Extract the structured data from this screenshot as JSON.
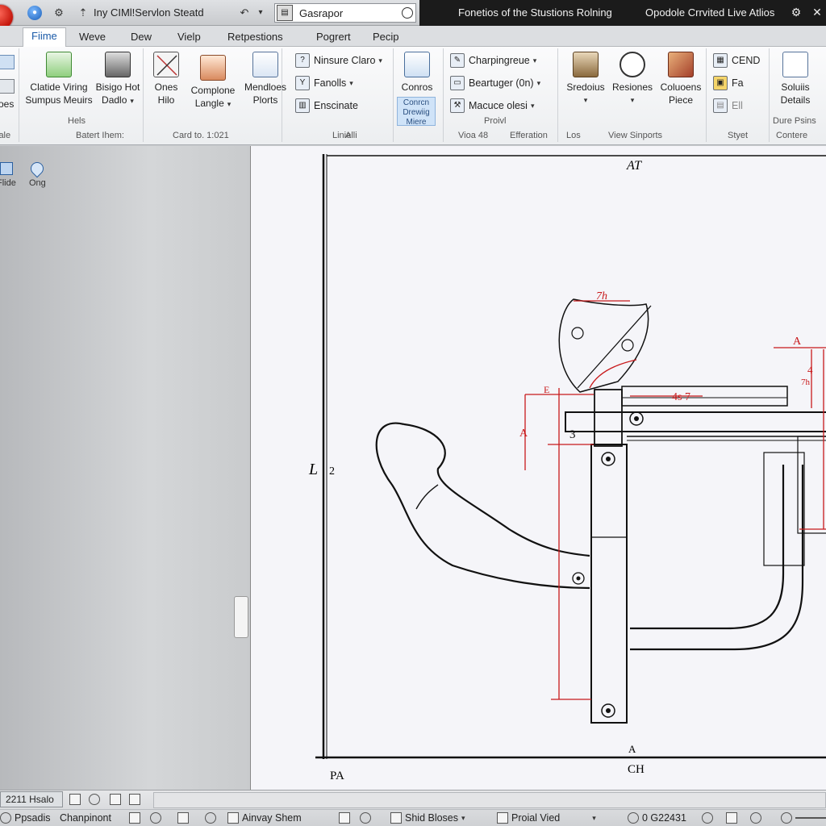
{
  "title_bar": {
    "app_title": "Iny CIMl!Servlon Steatd",
    "search_value": "Gasrapor",
    "right_title_1": "Fonetios of the Stustions Rolning",
    "right_title_2": "Opodole Crrvited Live Atlios",
    "icons": [
      "app-orb",
      "globe-icon",
      "gear-icon",
      "pin-icon",
      "undo-icon",
      "gear-icon",
      "close-icon"
    ]
  },
  "menu": {
    "items": [
      "Fiime",
      "Weve",
      "Dew",
      "Vielp",
      "Retpestions",
      "Pogrert",
      "Pecip"
    ],
    "active": "Fiime"
  },
  "ribbon": {
    "group1": {
      "btn_label": "oes",
      "small": "iale"
    },
    "group2": {
      "btn1": "Clatide Viring Sumpus Meuirs",
      "btn2": "Bisigo Hot Dadlo",
      "label_a": "Hels",
      "label_b": "Batert Ihem:"
    },
    "group3": {
      "btn1": "Ones Hilo",
      "btn2": "Complone Langle",
      "label": "Card to. 1:021"
    },
    "group4": {
      "btn1": "Mendloes Plorts"
    },
    "group5": {
      "s1": "Ninsure Claro",
      "s2": "Fanolls",
      "s3": "Enscinate",
      "label": "Linie"
    },
    "group6": {
      "btn1": "Conros",
      "btn2": "Conrcn Drewiig Miere",
      "label": "Alli"
    },
    "group7": {
      "s1": "Charpingreue",
      "s2": "Beartuger (0n)",
      "s3": "Macuce olesi",
      "label_a": "Proivl",
      "label_b": "Vioa 48",
      "label_c": "Efferation"
    },
    "group8": {
      "btn1": "Sredoius",
      "btn2": "Resiones",
      "btn3": "Coluoens Piece",
      "label_a": "Los",
      "label_b": "View Sinports"
    },
    "group9": {
      "s1": "CEND",
      "s2": "Fa",
      "s3": "Ell",
      "label": "Styet"
    },
    "group10": {
      "btn1": "Soluiis Details",
      "label_a": "Dure Psins",
      "label_b": "Contere"
    }
  },
  "left_panel": {
    "tool1": "Flide",
    "tool2": "Ong"
  },
  "drawing": {
    "labels": {
      "top": "AT",
      "left": "L",
      "left_sub": "2",
      "bottom_left": "PA",
      "bottom_center": "CH",
      "bottom_a": "A",
      "dim_top": "7h",
      "dim_mid": "4s 7",
      "dim_a": "A",
      "dim_3": "3",
      "dim_e": "E",
      "dim_right_a": "A",
      "dim_right_4": "4",
      "dim_right_7": "7h"
    }
  },
  "status_bar": {
    "row1": {
      "coord": "2211 Hsalo"
    },
    "row2": {
      "item1": "Ppsadis",
      "item2": "Chanpinont",
      "item3": "Ainvay Shem",
      "item4": "Shid Bloses",
      "item5": "Proial Vied",
      "item6": "0 G22431"
    }
  }
}
